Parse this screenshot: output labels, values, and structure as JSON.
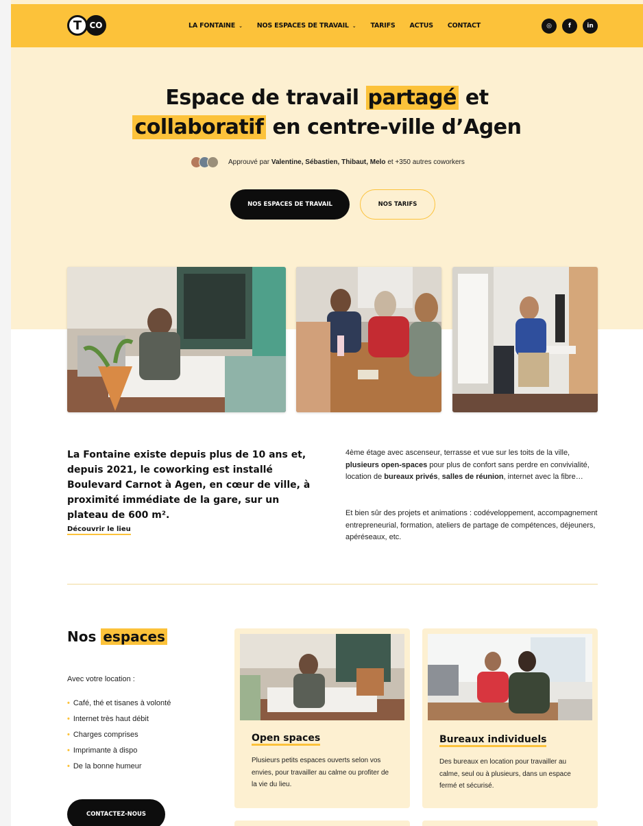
{
  "header": {
    "logo": {
      "t": "T",
      "co": "CO"
    },
    "nav": [
      {
        "label": "LA FONTAINE",
        "dropdown": true
      },
      {
        "label": "NOS ESPACES DE TRAVAIL",
        "dropdown": true
      },
      {
        "label": "TARIFS",
        "dropdown": false
      },
      {
        "label": "ACTUS",
        "dropdown": false
      },
      {
        "label": "CONTACT",
        "dropdown": false
      }
    ],
    "socials": [
      {
        "icon": "instagram-icon",
        "glyph": "◎"
      },
      {
        "icon": "facebook-icon",
        "glyph": "f"
      },
      {
        "icon": "linkedin-icon",
        "glyph": "in"
      }
    ],
    "accent": "#fcc23a"
  },
  "hero": {
    "title_line1_a": "Espace de travail",
    "title_line1_hl": "partagé",
    "title_line1_b": "et",
    "title_line2_hl": "collaboratif",
    "title_line2_b": "en centre-ville d’Agen",
    "approved_prefix": "Approuvé par",
    "approved_names": "Valentine, Sébastien, Thibaut, Melo",
    "approved_suffix": "et +350 autres coworkers",
    "btn_primary": "NOS ESPACES DE TRAVAIL",
    "btn_secondary": "NOS TARIFS"
  },
  "intro": {
    "lead": "La Fontaine existe depuis plus de 10 ans et, depuis 2021, le coworking est installé Boulevard Carnot à Agen, en cœur de ville, à proximité immédiate de la gare, sur un plateau de 600 m².",
    "link": "Découvrir le lieu",
    "p1_a": "4ème étage avec ascenseur, terrasse et vue sur les toits de la ville,",
    "p1_b": "plusieurs open-spaces",
    "p1_c": "pour plus de confort sans perdre en convivialité, location de",
    "p1_d": "bureaux privés",
    "p1_e": ",",
    "p1_f": "salles de réunion",
    "p1_g": ", internet avec la fibre…",
    "p2": "Et bien sûr des projets et animations : codéveloppement, accompagnement entrepreneurial, formation, ateliers de partage de compétences, déjeuners, apéréseaux, etc."
  },
  "espaces": {
    "title_a": "Nos",
    "title_hl": "espaces",
    "subtitle": "Avec votre location :",
    "features": [
      "Café, thé et tisanes à volonté",
      "Internet très haut débit",
      "Charges comprises",
      "Imprimante à dispo",
      "De la bonne humeur"
    ],
    "cta": "CONTACTEZ-NOUS",
    "cards": [
      {
        "title": "Open spaces",
        "desc": "Plusieurs petits espaces ouverts selon vos envies, pour travailler au calme ou profiter de la vie du lieu."
      },
      {
        "title": "Bureaux individuels",
        "desc": "Des bureaux en location pour travailler au calme, seul ou à plusieurs, dans un espace fermé et sécurisé."
      }
    ]
  }
}
